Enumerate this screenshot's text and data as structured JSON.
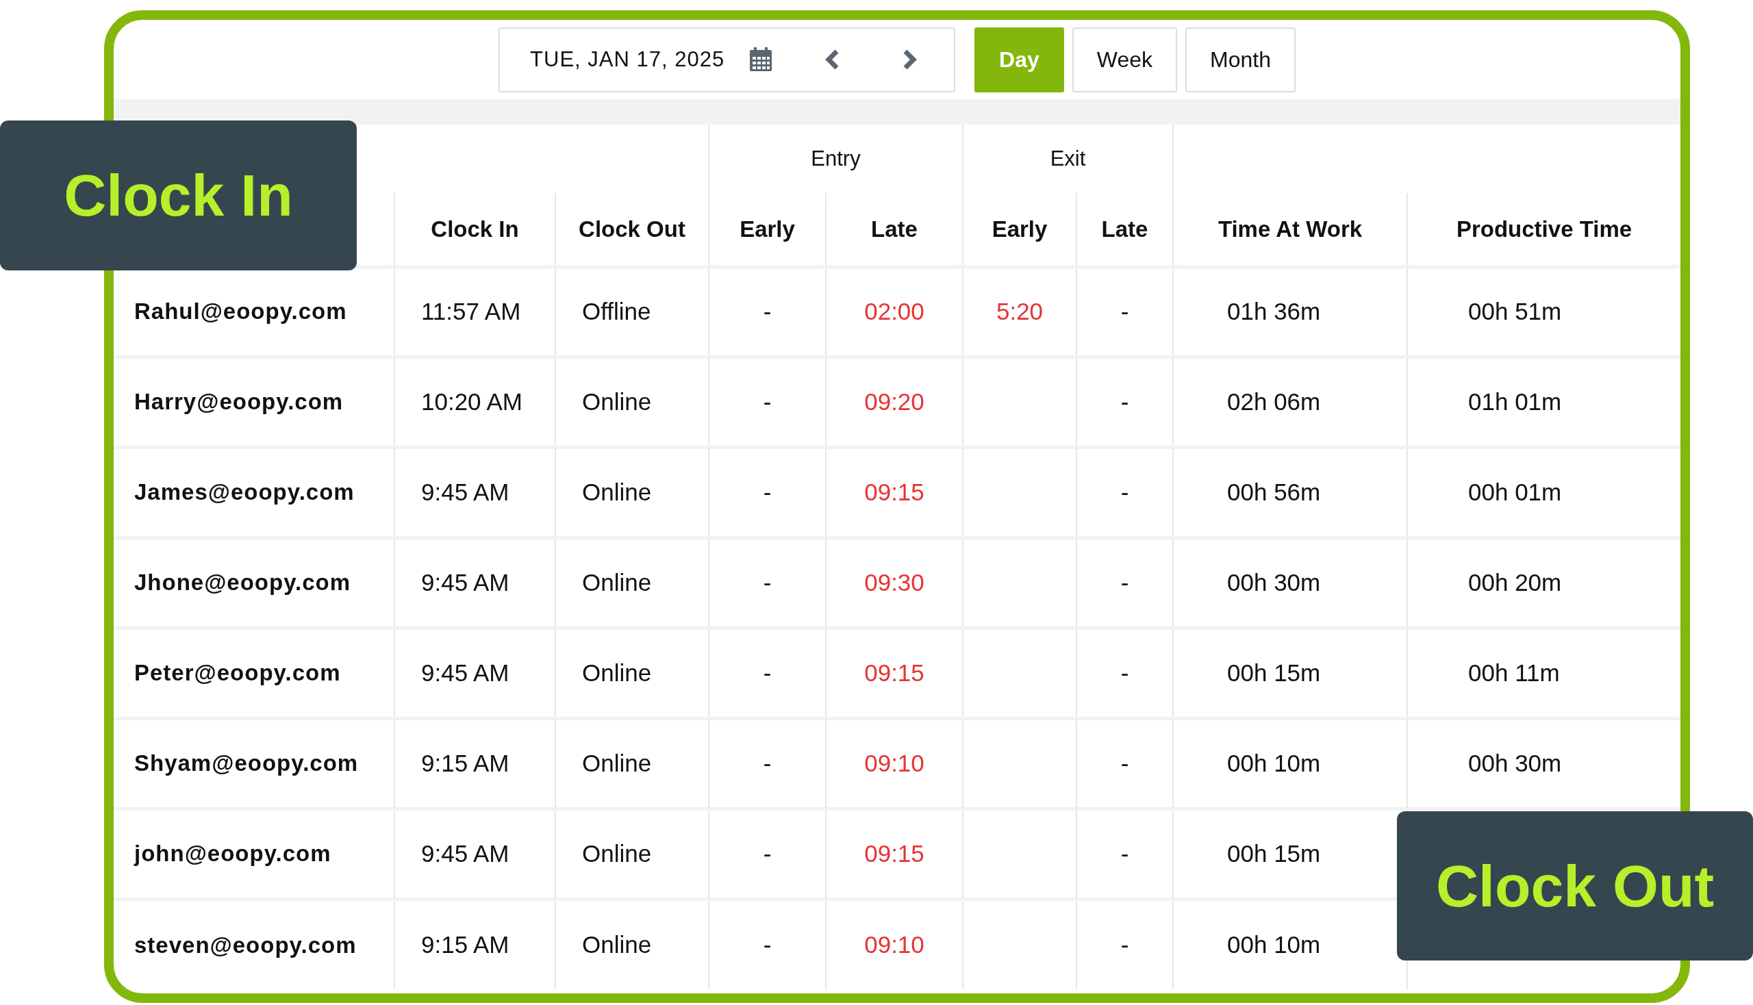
{
  "date_picker": {
    "date": "TUE, JAN 17, 2025"
  },
  "view_tabs": [
    {
      "label": "Day",
      "selected": true
    },
    {
      "label": "Week",
      "selected": false
    },
    {
      "label": "Month",
      "selected": false
    }
  ],
  "table": {
    "header_groups": [
      "Entry",
      "Exit"
    ],
    "columns": [
      "Clock In",
      "Clock Out",
      "Early",
      "Late",
      "Early",
      "Late",
      "Time At Work",
      "Productive Time"
    ],
    "rows": [
      {
        "email": "Rahul@eoopy.com",
        "clock_in": "11:57 AM",
        "clock_out": "Offline",
        "entry_early": "-",
        "entry_late": "02:00",
        "exit_early": "5:20",
        "exit_late": "-",
        "time_at_work": "01h 36m",
        "productive_time": "00h 51m"
      },
      {
        "email": "Harry@eoopy.com",
        "clock_in": "10:20 AM",
        "clock_out": "Online",
        "entry_early": "-",
        "entry_late": "09:20",
        "exit_late": "-",
        "time_at_work": "02h 06m",
        "productive_time": "01h 01m"
      },
      {
        "email": "James@eoopy.com",
        "clock_in": "9:45 AM",
        "clock_out": "Online",
        "entry_early": "-",
        "entry_late": "09:15",
        "exit_late": "-",
        "time_at_work": "00h 56m",
        "productive_time": "00h 01m"
      },
      {
        "email": "Jhone@eoopy.com",
        "clock_in": "9:45 AM",
        "clock_out": "Online",
        "entry_early": "-",
        "entry_late": "09:30",
        "exit_late": "-",
        "time_at_work": "00h 30m",
        "productive_time": "00h 20m"
      },
      {
        "email": "Peter@eoopy.com",
        "clock_in": "9:45 AM",
        "clock_out": "Online",
        "entry_early": "-",
        "entry_late": "09:15",
        "exit_late": "-",
        "time_at_work": "00h 15m",
        "productive_time": "00h 11m"
      },
      {
        "email": "Shyam@eoopy.com",
        "clock_in": "9:15 AM",
        "clock_out": "Online",
        "entry_early": "-",
        "entry_late": "09:10",
        "exit_late": "-",
        "time_at_work": "00h 10m",
        "productive_time": "00h 30m"
      },
      {
        "email": "john@eoopy.com",
        "clock_in": "9:45 AM",
        "clock_out": "Online",
        "entry_early": "-",
        "entry_late": "09:15",
        "exit_late": "-",
        "time_at_work": "00h 15m"
      },
      {
        "email": "steven@eoopy.com",
        "clock_in": "9:15 AM",
        "clock_out": "Online",
        "entry_early": "-",
        "entry_late": "09:10",
        "exit_late": "-",
        "time_at_work": "00h 10m"
      }
    ]
  },
  "callouts": [
    {
      "text": "Clock In"
    },
    {
      "text": "Clock Out"
    }
  ]
}
